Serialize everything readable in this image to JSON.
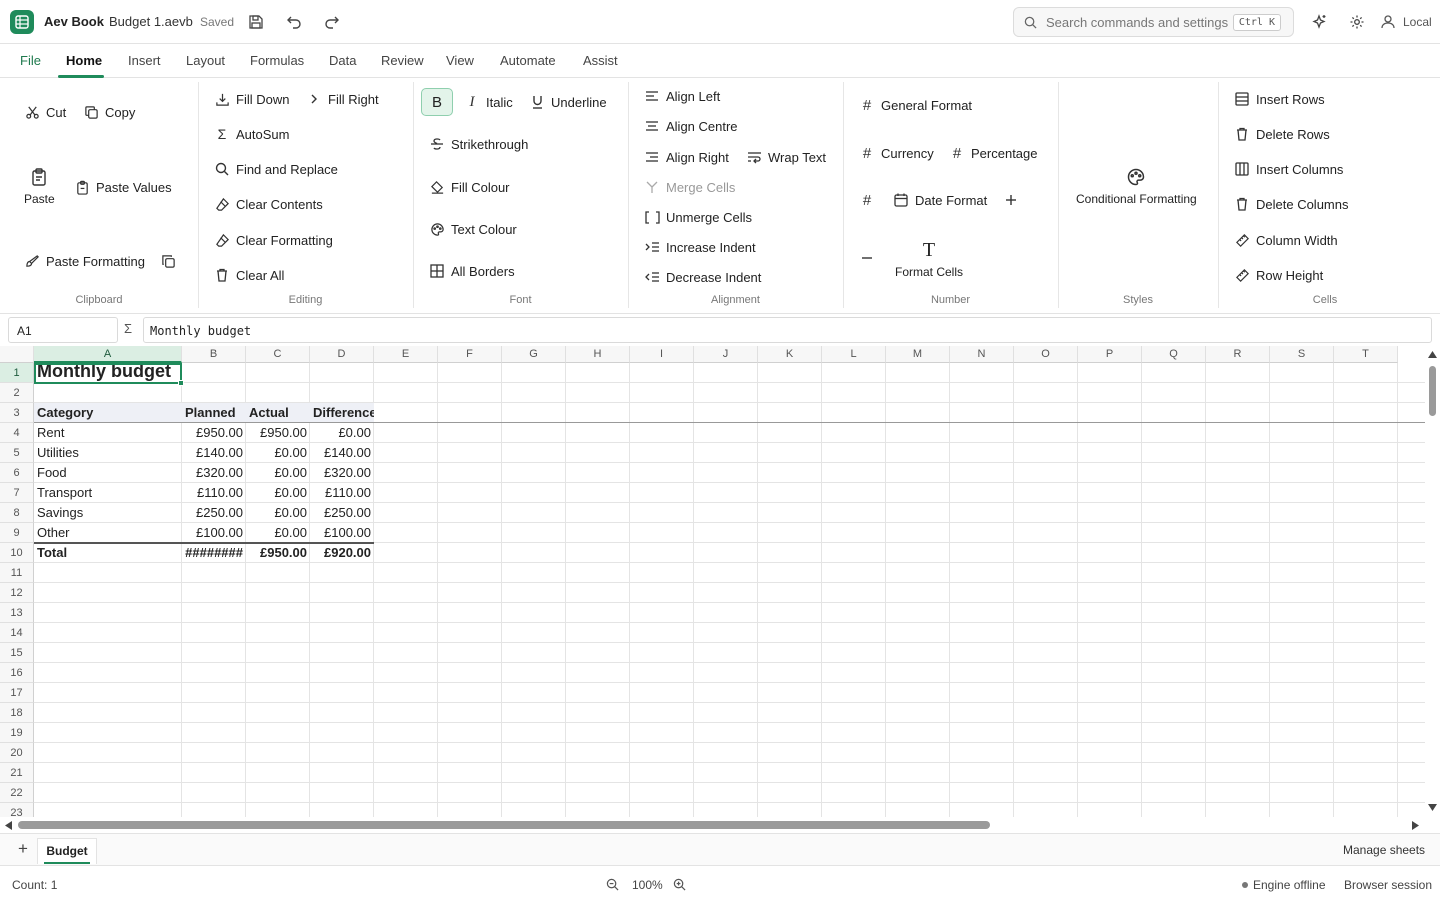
{
  "app": {
    "name": "Aev Book",
    "filename": "Budget 1.aevb",
    "saved": "Saved"
  },
  "search": {
    "placeholder": "Search commands and settings",
    "shortcut": "Ctrl K"
  },
  "user": {
    "label": "Local"
  },
  "menu": {
    "tabs": [
      "File",
      "Home",
      "Insert",
      "Layout",
      "Formulas",
      "Data",
      "Review",
      "View",
      "Automate",
      "Assist"
    ],
    "active": "Home"
  },
  "ribbon": {
    "clipboard": {
      "label": "Clipboard",
      "cut": "Cut",
      "copy": "Copy",
      "paste": "Paste",
      "paste_values": "Paste Values",
      "paste_formatting": "Paste Formatting"
    },
    "editing": {
      "label": "Editing",
      "fill_down": "Fill Down",
      "fill_right": "Fill Right",
      "autosum": "AutoSum",
      "find_replace": "Find and Replace",
      "clear_contents": "Clear Contents",
      "clear_formatting": "Clear Formatting",
      "clear_all": "Clear All"
    },
    "font": {
      "label": "Font",
      "bold": "B",
      "italic": "Italic",
      "underline": "Underline",
      "strikethrough": "Strikethrough",
      "fill_colour": "Fill Colour",
      "text_colour": "Text Colour",
      "all_borders": "All Borders"
    },
    "alignment": {
      "label": "Alignment",
      "align_left": "Align Left",
      "align_centre": "Align Centre",
      "align_right": "Align Right",
      "wrap_text": "Wrap Text",
      "merge_cells": "Merge Cells",
      "unmerge_cells": "Unmerge Cells",
      "increase_indent": "Increase Indent",
      "decrease_indent": "Decrease Indent"
    },
    "number": {
      "label": "Number",
      "general": "General Format",
      "currency": "Currency",
      "percentage": "Percentage",
      "date": "Date Format",
      "format_cells": "Format Cells"
    },
    "styles": {
      "label": "Styles",
      "conditional": "Conditional Formatting"
    },
    "cells": {
      "label": "Cells",
      "insert_rows": "Insert Rows",
      "delete_rows": "Delete Rows",
      "insert_columns": "Insert Columns",
      "delete_columns": "Delete Columns",
      "column_width": "Column Width",
      "row_height": "Row Height"
    }
  },
  "formula_bar": {
    "cell_ref": "A1",
    "sigma": "Σ",
    "content": "Monthly budget"
  },
  "grid": {
    "columns": [
      "A",
      "B",
      "C",
      "D",
      "E",
      "F",
      "G",
      "H",
      "I",
      "J",
      "K",
      "L",
      "M",
      "N",
      "O",
      "P",
      "Q",
      "R",
      "S",
      "T"
    ],
    "rows": [
      "1",
      "2",
      "3",
      "4",
      "5",
      "6",
      "7",
      "8",
      "9",
      "10",
      "11",
      "12",
      "13",
      "14",
      "15",
      "16",
      "17",
      "18",
      "19",
      "20",
      "21",
      "22",
      "23"
    ],
    "title": "Monthly budget",
    "headers": [
      "Category",
      "Planned",
      "Actual",
      "Difference"
    ],
    "data": [
      [
        "Rent",
        "£950.00",
        "£950.00",
        "£0.00"
      ],
      [
        "Utilities",
        "£140.00",
        "£0.00",
        "£140.00"
      ],
      [
        "Food",
        "£320.00",
        "£0.00",
        "£320.00"
      ],
      [
        "Transport",
        "£110.00",
        "£0.00",
        "£110.00"
      ],
      [
        "Savings",
        "£250.00",
        "£0.00",
        "£250.00"
      ],
      [
        "Other",
        "£100.00",
        "£0.00",
        "£100.00"
      ]
    ],
    "total": [
      "Total",
      "########",
      "£950.00",
      "£920.00"
    ]
  },
  "sheets": {
    "add": "+",
    "tabs": [
      "Budget"
    ],
    "manage": "Manage sheets"
  },
  "status": {
    "count": "Count: 1",
    "zoom": "100%",
    "engine": "Engine offline",
    "session": "Browser session"
  },
  "colors": {
    "accent": "#1f8b5b"
  }
}
